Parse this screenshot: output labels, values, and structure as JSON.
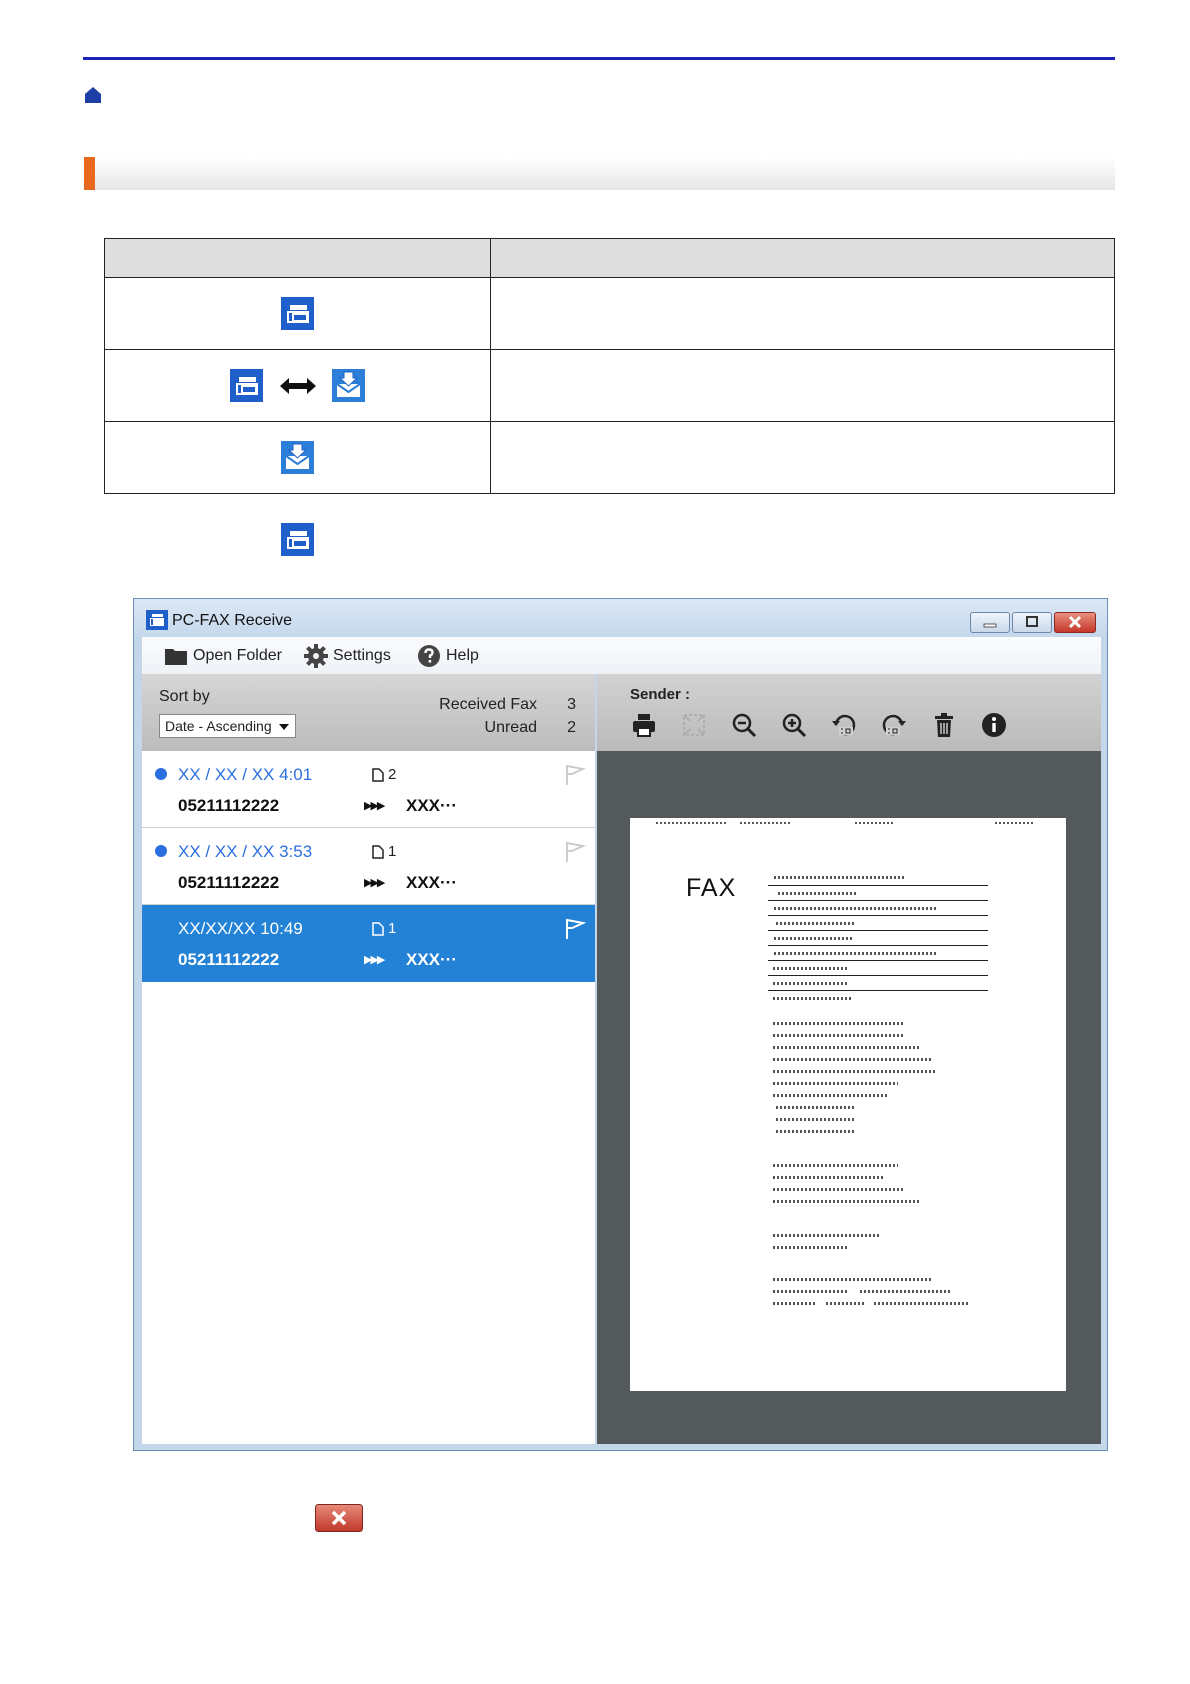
{
  "window": {
    "title": "PC-FAX Receive"
  },
  "menu": {
    "open_folder": "Open Folder",
    "settings": "Settings",
    "help": "Help"
  },
  "sort": {
    "label": "Sort by",
    "selected": "Date - Ascending"
  },
  "stats": {
    "received_label": "Received Fax",
    "received_value": "3",
    "unread_label": "Unread",
    "unread_value": "2"
  },
  "preview": {
    "sender_label": "Sender :",
    "fax_label": "FAX"
  },
  "fax_list": [
    {
      "date": "XX / XX / XX  4:01",
      "pages": "2",
      "number": "05211112222",
      "sender": "XXX···",
      "unread": true,
      "selected": false
    },
    {
      "date": "XX / XX / XX  3:53",
      "pages": "1",
      "number": "05211112222",
      "sender": "XXX···",
      "unread": true,
      "selected": false
    },
    {
      "date": "XX/XX/XX 10:49",
      "pages": "1",
      "number": "05211112222",
      "sender": "XXX···",
      "unread": false,
      "selected": true
    }
  ],
  "colors": {
    "top_rule": "#1a23b5",
    "section_accent": "#e8681d",
    "icon_blue": "#1f5fc9",
    "selection_blue": "#2382d6"
  }
}
